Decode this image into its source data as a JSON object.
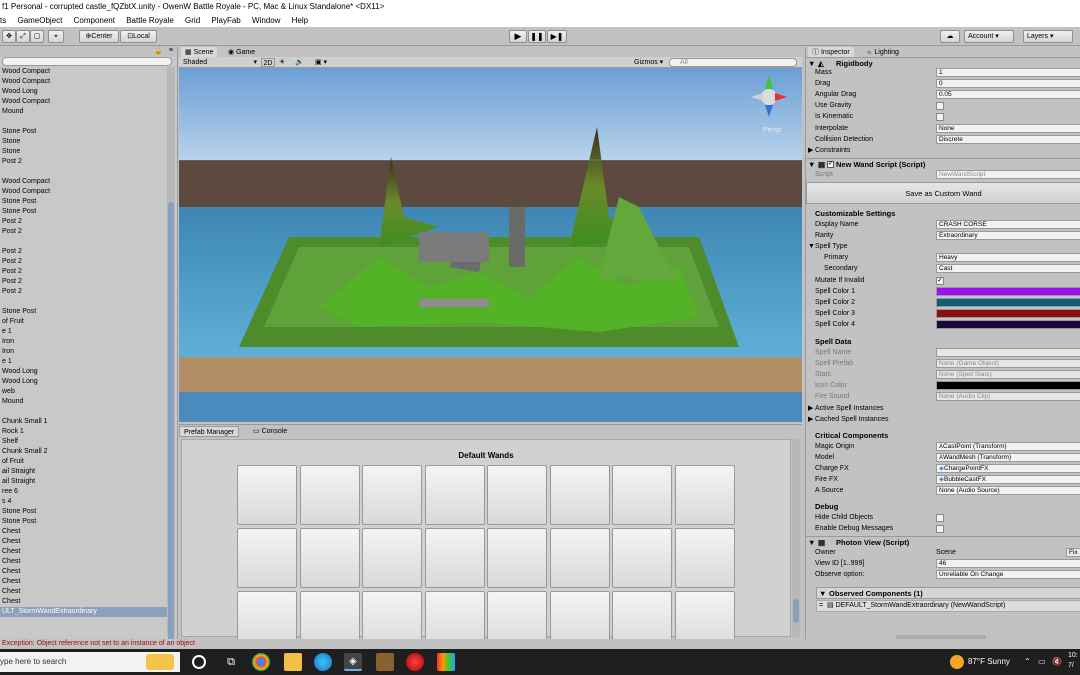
{
  "window": {
    "title": "f1 Personal - corrupted castle_fQZbtX.unity - OwenW Battle Royale - PC, Mac & Linux Standalone* <DX11>"
  },
  "menu": [
    "ts",
    "GameObject",
    "Component",
    "Battle Royale",
    "Grid",
    "PlayFab",
    "Window",
    "Help"
  ],
  "toolbar": {
    "center_label": "Center",
    "local_label": "Local",
    "account_label": "Account",
    "layers_label": "Layers"
  },
  "hierarchy": {
    "items": [
      "Wood Compact",
      "Wood Compact",
      "Wood Long",
      "Wood Compact",
      "Mound",
      "",
      "Stone Post",
      "Stone",
      "Stone",
      "Post 2",
      "",
      "Wood Compact",
      "Wood Compact",
      "Stone Post",
      "Stone Post",
      "Post 2",
      "Post 2",
      "",
      "Post 2",
      "Post 2",
      "Post 2",
      "Post 2",
      "Post 2",
      "",
      "Stone Post",
      "of Fruit",
      "e 1",
      "Iron",
      "Iron",
      "e 1",
      "Wood Long",
      "Wood Long",
      "web",
      "Mound",
      "",
      "Chunk Small 1",
      "Rock 1",
      "Shelf",
      "Chunk Small 2",
      "of Fruit",
      "ail Straight",
      "ail Straight",
      "ree 6",
      "s 4",
      "Stone Post",
      "Stone Post",
      "Chest",
      "Chest",
      "Chest",
      "Chest",
      "Chest",
      "Chest",
      "Chest",
      "Chest",
      "ULT_StormWandExtraordinary"
    ]
  },
  "scene": {
    "tab_scene": "Scene",
    "tab_game": "Game",
    "shading": "Shaded",
    "mode_2d": "2D",
    "gizmos": "Gizmos",
    "search_placeholder": "All",
    "persp_label": "Persp"
  },
  "prefab_manager": {
    "tab_prefab": "Prefab Manager",
    "tab_console": "Console",
    "section_title": "Default Wands"
  },
  "inspector": {
    "tab_inspector": "Inspector",
    "tab_lighting": "Lighting",
    "rigidbody": {
      "title": "Rigidbody",
      "mass_label": "Mass",
      "mass": "1",
      "drag_label": "Drag",
      "drag": "0",
      "angular_drag_label": "Angular Drag",
      "angular_drag": "0.05",
      "use_gravity_label": "Use Gravity",
      "is_kinematic_label": "Is Kinematic",
      "interpolate_label": "Interpolate",
      "interpolate": "None",
      "collision_label": "Collision Detection",
      "collision": "Discrete",
      "constraints_label": "Constraints"
    },
    "wand_script": {
      "title": "New Wand Script (Script)",
      "script_label": "Script",
      "script": "NewWandScript",
      "save_button": "Save as Custom Wand",
      "customizable_title": "Customizable Settings",
      "display_name_label": "Display Name",
      "display_name": "CRASH CORSE",
      "rarity_label": "Rarity",
      "rarity": "Extraordinary",
      "spell_type_label": "Spell Type",
      "primary_label": "Primary",
      "primary": "Heavy",
      "secondary_label": "Secondary",
      "secondary": "Cast",
      "mutate_label": "Mutate If Invalid",
      "color1_label": "Spell Color 1",
      "color2_label": "Spell Color 2",
      "color3_label": "Spell Color 3",
      "color4_label": "Spell Color 4",
      "spell_data_title": "Spell Data",
      "spell_name_label": "Spell Name",
      "spell_prefab_label": "Spell Prefab",
      "spell_prefab": "None (Game Object)",
      "stats_label": "Stats",
      "stats": "None (Spell Stats)",
      "icon_color_label": "Icon Color",
      "fire_sound_label": "Fire Sound",
      "fire_sound": "None (Audio Clip)",
      "active_instances_label": "Active Spell Instances",
      "cached_instances_label": "Cached Spell Instances",
      "critical_title": "Critical Components",
      "magic_origin_label": "Magic Origin",
      "magic_origin": "CastPoint (Transform)",
      "model_label": "Model",
      "model": "WandMesh (Transform)",
      "charge_fx_label": "Charge FX",
      "charge_fx": "ChargePointFX",
      "fire_fx_label": "Fire FX",
      "fire_fx": "BubbleCastFX",
      "a_source_label": "A Source",
      "a_source": "None (Audio Source)",
      "debug_title": "Debug",
      "hide_child_label": "Hide Child Objects",
      "enable_debug_label": "Enable Debug Messages"
    },
    "photon_view": {
      "title": "Photon View (Script)",
      "owner_label": "Owner",
      "owner": "Scene",
      "fix_button": "Fix",
      "view_id_label": "View ID [1..999]",
      "view_id": "46",
      "observe_label": "Observe option:",
      "observe": "Unreliable On Change",
      "observed_title": "Observed Components (1)",
      "observed_item": "DEFAULT_StormWandExtraordinary (NewWandScript)"
    }
  },
  "console": {
    "error": "Exception: Object reference not set to an instance of an object"
  },
  "taskbar": {
    "search_placeholder": "ype here to search",
    "weather": "87°F  Sunny",
    "time": "10:",
    "date": "7/"
  },
  "colors": {
    "spell_color_1": "#9b10f0",
    "spell_color_2": "#0e5f73",
    "spell_color_3": "#8a1010",
    "spell_color_4": "#1a0a3a",
    "icon_color": "#000000"
  }
}
